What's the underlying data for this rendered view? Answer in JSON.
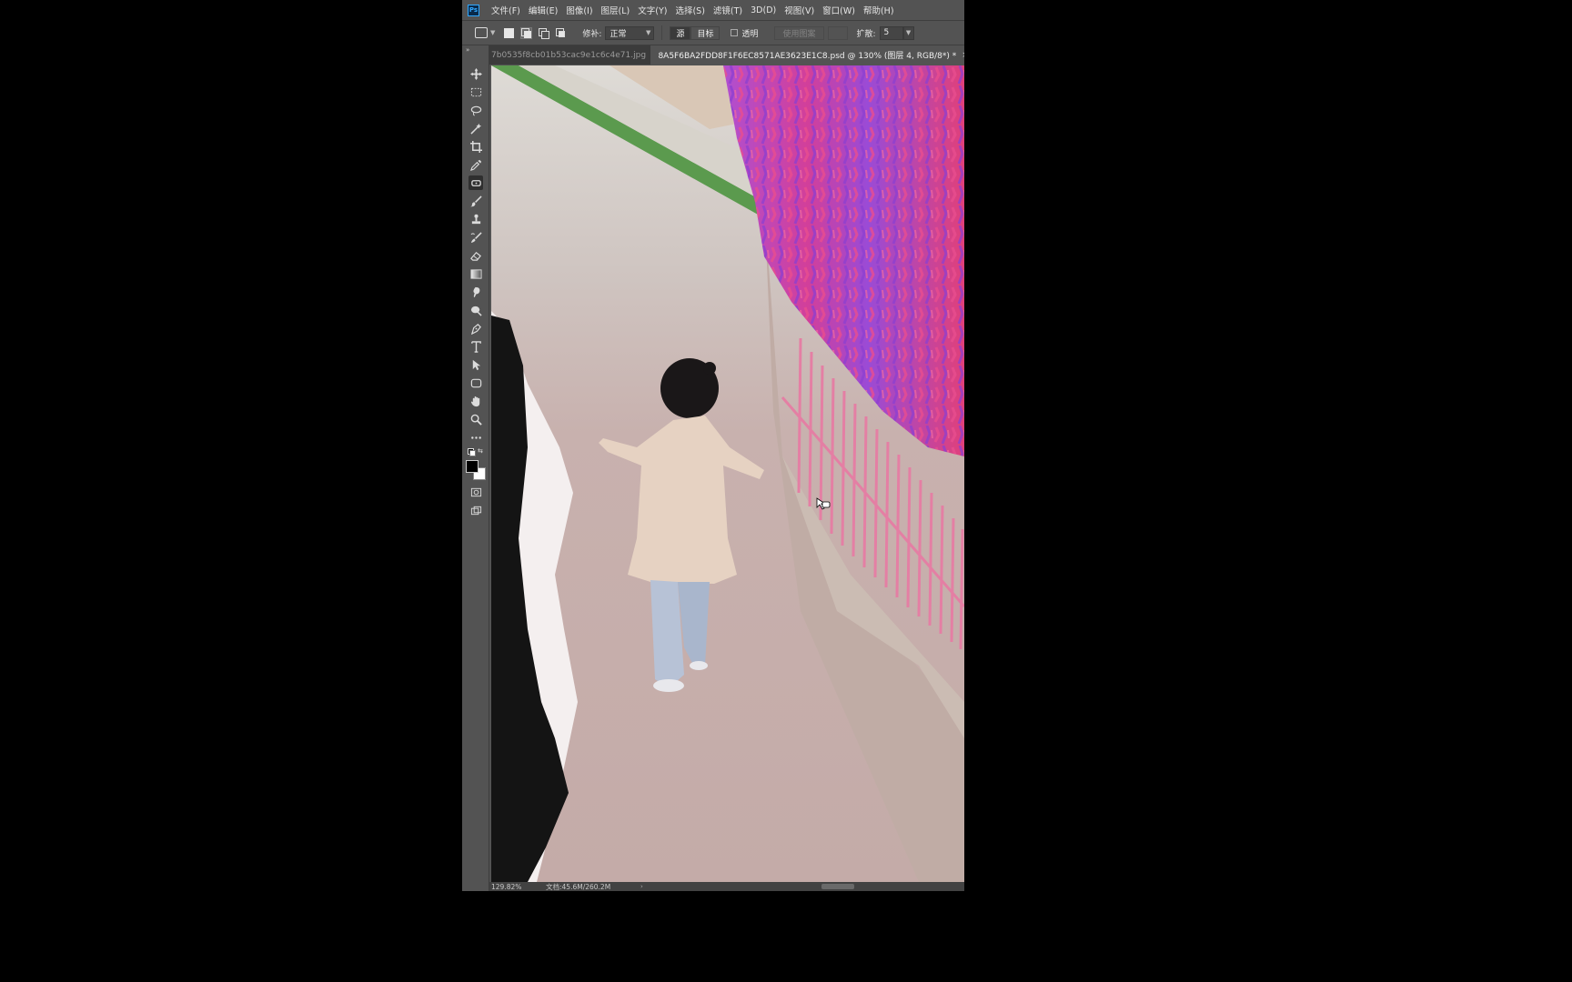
{
  "app": {
    "logo_text": "Ps"
  },
  "menu": [
    "文件(F)",
    "编辑(E)",
    "图像(I)",
    "图层(L)",
    "文字(Y)",
    "选择(S)",
    "滤镜(T)",
    "3D(D)",
    "视图(V)",
    "窗口(W)",
    "帮助(H)"
  ],
  "options": {
    "patch_label": "修补:",
    "patch_mode": "正常",
    "source_label": "源",
    "target_label": "目标",
    "transparent_label": "透明",
    "use_pattern_label": "使用图案",
    "diffusion_label": "扩散:",
    "diffusion_value": "5"
  },
  "tabs": [
    {
      "label": "7b0535f8cb01b53cac9e1c6c4e71.jpg",
      "close": "×",
      "active": false
    },
    {
      "label": "8A5F6BA2FDD8F1F6EC8571AE3623E1C8.psd @ 130% (图层 4, RGB/8*) *",
      "close": "×",
      "active": true
    }
  ],
  "tools": [
    "move-tool-icon",
    "marquee-tool-icon",
    "lasso-tool-icon",
    "magic-wand-icon",
    "crop-tool-icon",
    "eyedropper-icon",
    "patch-tool-icon",
    "brush-tool-icon",
    "clone-stamp-icon",
    "history-brush-icon",
    "eraser-icon",
    "gradient-tool-icon",
    "smudge-tool-icon",
    "dodge-tool-icon",
    "pen-tool-icon",
    "type-tool-icon",
    "path-selection-icon",
    "shape-tool-icon",
    "hand-tool-icon",
    "zoom-tool-icon",
    "more-tools-icon"
  ],
  "colors": {
    "foreground": "#000000",
    "background": "#ffffff"
  },
  "status": {
    "zoom": "129.82%",
    "doc_info": "文档:45.6M/260.2M",
    "arrow": "›"
  }
}
